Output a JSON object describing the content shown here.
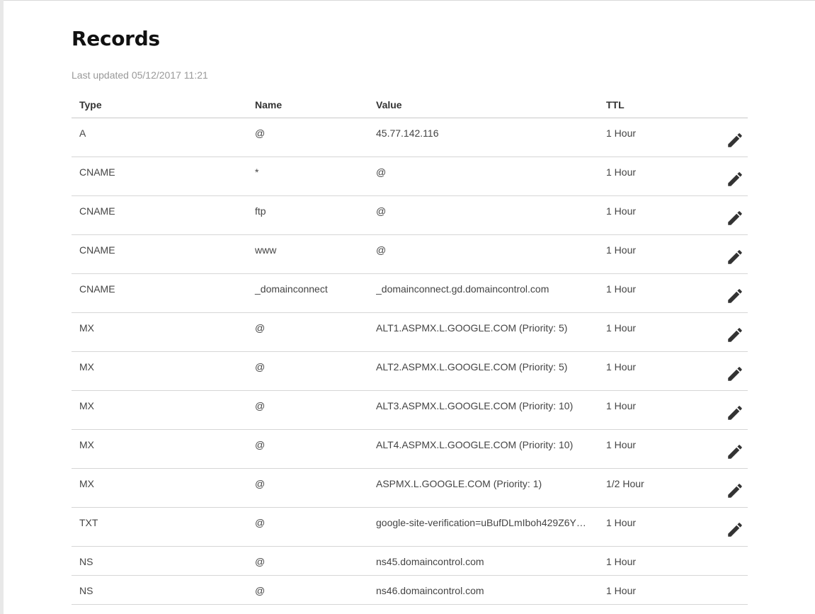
{
  "page": {
    "title": "Records",
    "last_updated": "Last updated 05/12/2017 11:21"
  },
  "table": {
    "columns": {
      "type": "Type",
      "name": "Name",
      "value": "Value",
      "ttl": "TTL"
    },
    "rows": [
      {
        "type": "A",
        "name": "@",
        "value": "45.77.142.116",
        "ttl": "1 Hour",
        "editable": true
      },
      {
        "type": "CNAME",
        "name": "*",
        "value": "@",
        "ttl": "1 Hour",
        "editable": true
      },
      {
        "type": "CNAME",
        "name": "ftp",
        "value": "@",
        "ttl": "1 Hour",
        "editable": true
      },
      {
        "type": "CNAME",
        "name": "www",
        "value": "@",
        "ttl": "1 Hour",
        "editable": true
      },
      {
        "type": "CNAME",
        "name": "_domainconnect",
        "value": "_domainconnect.gd.domaincontrol.com",
        "ttl": "1 Hour",
        "editable": true
      },
      {
        "type": "MX",
        "name": "@",
        "value": "ALT1.ASPMX.L.GOOGLE.COM (Priority: 5)",
        "ttl": "1 Hour",
        "editable": true
      },
      {
        "type": "MX",
        "name": "@",
        "value": "ALT2.ASPMX.L.GOOGLE.COM (Priority: 5)",
        "ttl": "1 Hour",
        "editable": true
      },
      {
        "type": "MX",
        "name": "@",
        "value": "ALT3.ASPMX.L.GOOGLE.COM (Priority: 10)",
        "ttl": "1 Hour",
        "editable": true
      },
      {
        "type": "MX",
        "name": "@",
        "value": "ALT4.ASPMX.L.GOOGLE.COM (Priority: 10)",
        "ttl": "1 Hour",
        "editable": true
      },
      {
        "type": "MX",
        "name": "@",
        "value": "ASPMX.L.GOOGLE.COM (Priority: 1)",
        "ttl": "1/2 Hour",
        "editable": true
      },
      {
        "type": "TXT",
        "name": "@",
        "value": "google-site-verification=uBufDLmIboh429Z6Y…",
        "ttl": "1 Hour",
        "editable": true
      },
      {
        "type": "NS",
        "name": "@",
        "value": "ns45.domaincontrol.com",
        "ttl": "1 Hour",
        "editable": false
      },
      {
        "type": "NS",
        "name": "@",
        "value": "ns46.domaincontrol.com",
        "ttl": "1 Hour",
        "editable": false
      }
    ]
  },
  "icons": {
    "edit": "pencil-icon"
  },
  "colors": {
    "text": "#444444",
    "title": "#111111",
    "muted": "#999999",
    "icon": "#333333"
  }
}
